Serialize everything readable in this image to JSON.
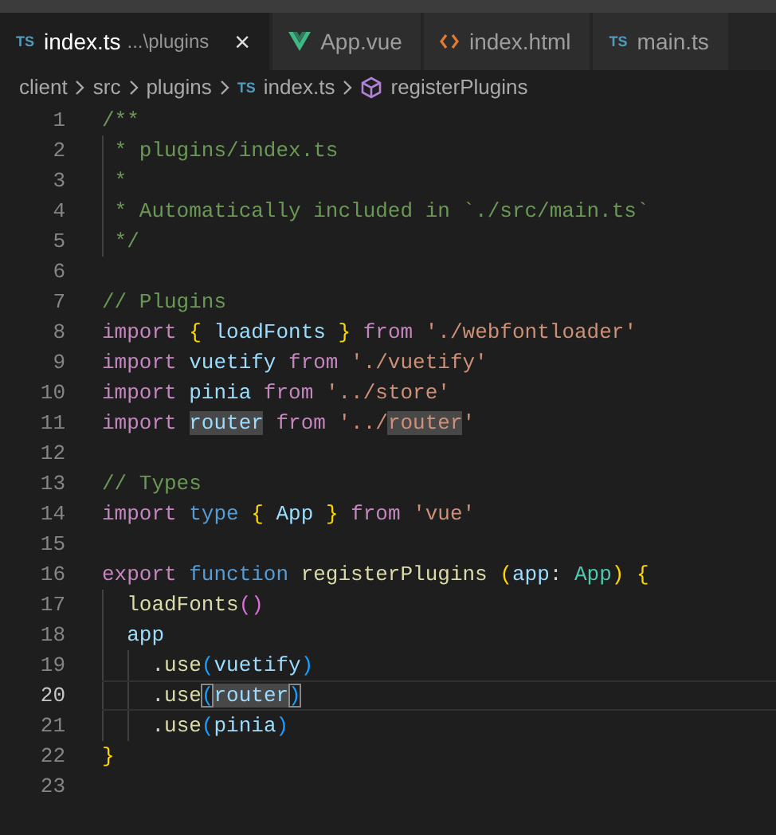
{
  "tabs": [
    {
      "kind": "ts",
      "icon_text": "TS",
      "label": "index.ts",
      "description": "...\\plugins",
      "close": "×",
      "selected": true
    },
    {
      "kind": "vue",
      "label": "App.vue",
      "selected": false
    },
    {
      "kind": "html",
      "label": "index.html",
      "selected": false
    },
    {
      "kind": "ts",
      "icon_text": "TS",
      "label": "main.ts",
      "selected": false
    }
  ],
  "breadcrumb": [
    {
      "label": "client"
    },
    {
      "label": "src"
    },
    {
      "label": "plugins"
    },
    {
      "kind": "ts",
      "icon_text": "TS",
      "label": "index.ts"
    },
    {
      "kind": "symbol",
      "label": "registerPlugins"
    }
  ],
  "lines": [
    {
      "number": "1",
      "current": false,
      "tokens": [
        {
          "text": "/**",
          "kind": "com"
        }
      ]
    },
    {
      "number": "2",
      "current": false,
      "tokens": [
        {
          "text": " * plugins/index.ts",
          "kind": "com"
        }
      ]
    },
    {
      "number": "3",
      "current": false,
      "tokens": [
        {
          "text": " *",
          "kind": "com"
        }
      ]
    },
    {
      "number": "4",
      "current": false,
      "tokens": [
        {
          "text": " * Automatically included in `./src/main.ts`",
          "kind": "com"
        }
      ]
    },
    {
      "number": "5",
      "current": false,
      "tokens": [
        {
          "text": " */",
          "kind": "com"
        }
      ]
    },
    {
      "number": "6",
      "current": false
    },
    {
      "number": "7",
      "current": false,
      "tokens": [
        {
          "text": "// Plugins",
          "kind": "com"
        }
      ]
    },
    {
      "number": "8",
      "current": false,
      "tokens": [
        {
          "text": "import ",
          "kind": "kw"
        },
        {
          "text": "{",
          "kind": "b1"
        },
        {
          "text": " loadFonts ",
          "kind": "var"
        },
        {
          "text": "}",
          "kind": "b1"
        },
        {
          "text": " from ",
          "kind": "kw"
        },
        {
          "text": "'./webfontloader'",
          "kind": "str"
        }
      ]
    },
    {
      "number": "9",
      "current": false,
      "tokens": [
        {
          "text": "import ",
          "kind": "kw"
        },
        {
          "text": "vuetify",
          "kind": "var"
        },
        {
          "text": " from ",
          "kind": "kw"
        },
        {
          "text": "'./vuetify'",
          "kind": "str"
        }
      ]
    },
    {
      "number": "10",
      "current": false,
      "tokens": [
        {
          "text": "import ",
          "kind": "kw"
        },
        {
          "text": "pinia",
          "kind": "var"
        },
        {
          "text": " from ",
          "kind": "kw"
        },
        {
          "text": "'../store'",
          "kind": "str"
        }
      ]
    },
    {
      "number": "11",
      "current": false,
      "tokens": [
        {
          "text": "import ",
          "kind": "kw"
        },
        {
          "text": "router",
          "kind": "var",
          "hl": true
        },
        {
          "text": " from ",
          "kind": "kw"
        },
        {
          "text": "'../",
          "kind": "str"
        },
        {
          "text": "router",
          "kind": "str",
          "hl": true
        },
        {
          "text": "'",
          "kind": "str"
        }
      ]
    },
    {
      "number": "12",
      "current": false
    },
    {
      "number": "13",
      "current": false,
      "tokens": [
        {
          "text": "// Types",
          "kind": "com"
        }
      ]
    },
    {
      "number": "14",
      "current": false,
      "tokens": [
        {
          "text": "import ",
          "kind": "kw"
        },
        {
          "text": "type ",
          "kind": "kw2"
        },
        {
          "text": "{",
          "kind": "b1"
        },
        {
          "text": " App ",
          "kind": "var"
        },
        {
          "text": "}",
          "kind": "b1"
        },
        {
          "text": " from ",
          "kind": "kw"
        },
        {
          "text": "'vue'",
          "kind": "str"
        }
      ]
    },
    {
      "number": "15",
      "current": false
    },
    {
      "number": "16",
      "current": false,
      "tokens": [
        {
          "text": "export ",
          "kind": "kw"
        },
        {
          "text": "function ",
          "kind": "kw2"
        },
        {
          "text": "registerPlugins ",
          "kind": "fn"
        },
        {
          "text": "(",
          "kind": "b1"
        },
        {
          "text": "app",
          "kind": "var"
        },
        {
          "text": ": ",
          "kind": "plain"
        },
        {
          "text": "App",
          "kind": "type"
        },
        {
          "text": ") ",
          "kind": "b1"
        },
        {
          "text": "{",
          "kind": "b1"
        }
      ]
    },
    {
      "number": "17",
      "current": false,
      "tokens": [
        {
          "text": "  loadFonts",
          "kind": "fn"
        },
        {
          "text": "()",
          "kind": "b2"
        }
      ]
    },
    {
      "number": "18",
      "current": false,
      "tokens": [
        {
          "text": "  app",
          "kind": "var"
        }
      ]
    },
    {
      "number": "19",
      "current": false,
      "tokens": [
        {
          "text": "    .",
          "kind": "plain"
        },
        {
          "text": "use",
          "kind": "fn"
        },
        {
          "text": "(",
          "kind": "b3"
        },
        {
          "text": "vuetify",
          "kind": "var"
        },
        {
          "text": ")",
          "kind": "b3"
        }
      ]
    },
    {
      "number": "20",
      "current": true,
      "tokens": [
        {
          "text": "    .",
          "kind": "plain"
        },
        {
          "text": "use",
          "kind": "fn"
        },
        {
          "text": "(",
          "kind": "b3",
          "match": true
        },
        {
          "text": "router",
          "kind": "var",
          "hl": true
        },
        {
          "text": ")",
          "kind": "b3",
          "match": true
        }
      ]
    },
    {
      "number": "21",
      "current": false,
      "tokens": [
        {
          "text": "    .",
          "kind": "plain"
        },
        {
          "text": "use",
          "kind": "fn"
        },
        {
          "text": "(",
          "kind": "b3"
        },
        {
          "text": "pinia",
          "kind": "var"
        },
        {
          "text": ")",
          "kind": "b3"
        }
      ]
    },
    {
      "number": "22",
      "current": false,
      "tokens": [
        {
          "text": "}",
          "kind": "b1"
        }
      ]
    },
    {
      "number": "23",
      "current": false
    }
  ]
}
